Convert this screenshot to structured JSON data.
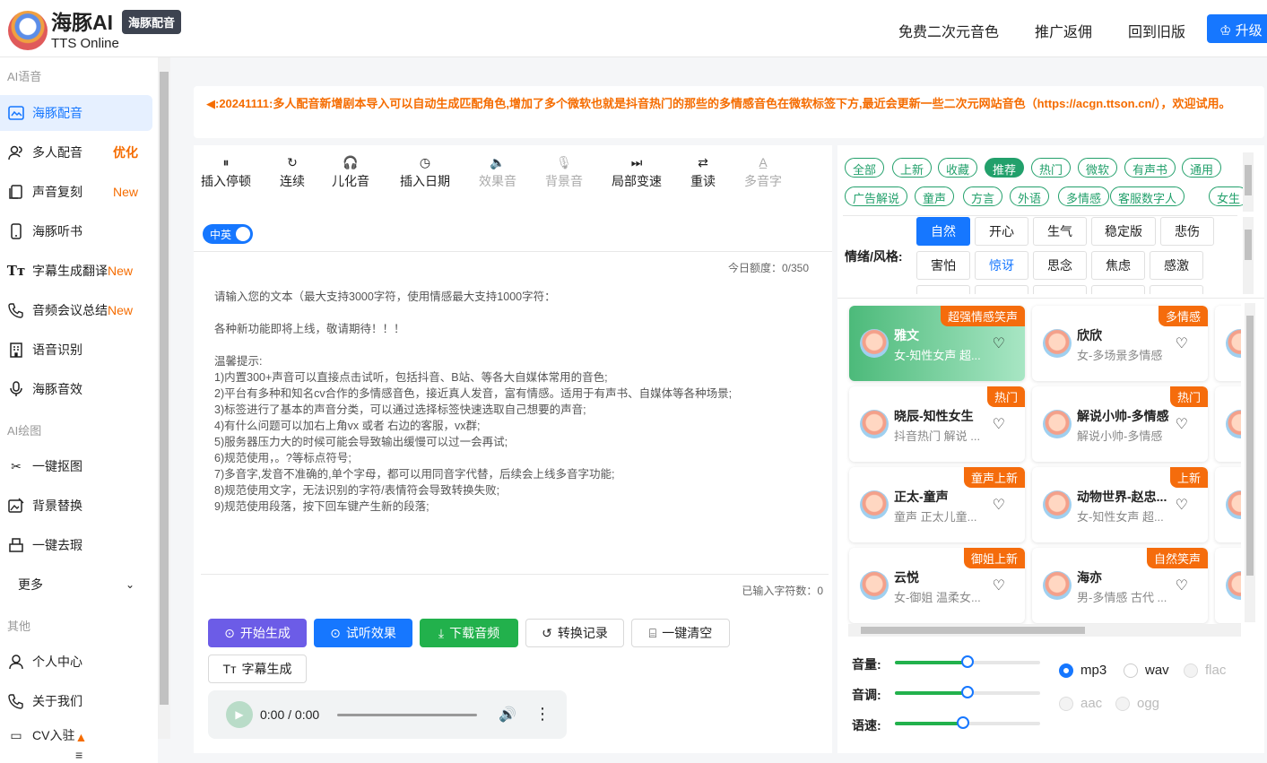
{
  "header": {
    "brand": "海豚AI",
    "brand_tag": "海豚配音",
    "brand_sub": "TTS Online",
    "nav": [
      "免费二次元音色",
      "推广返佣",
      "回到旧版"
    ],
    "upgrade": "升级"
  },
  "sidebar": {
    "sec_voice": "AI语音",
    "sec_draw": "AI绘图",
    "sec_other": "其他",
    "items": [
      {
        "label": "海豚配音",
        "badge": ""
      },
      {
        "label": "多人配音",
        "badge": "优化"
      },
      {
        "label": "声音复刻",
        "badge": "New"
      },
      {
        "label": "海豚听书",
        "badge": ""
      },
      {
        "label": "字幕生成翻译",
        "badge": "New"
      },
      {
        "label": "音频会议总结",
        "badge": "New"
      },
      {
        "label": "语音识别",
        "badge": ""
      },
      {
        "label": "海豚音效",
        "badge": ""
      },
      {
        "label": "一键抠图",
        "badge": ""
      },
      {
        "label": "背景替换",
        "badge": ""
      },
      {
        "label": "一键去瑕",
        "badge": ""
      },
      {
        "label": "更多",
        "badge": ""
      },
      {
        "label": "个人中心",
        "badge": ""
      },
      {
        "label": "关于我们",
        "badge": ""
      },
      {
        "label": "CV入驻",
        "badge": ""
      }
    ]
  },
  "notice": "◀:20241111:多人配音新增剧本导入可以自动生成匹配角色,增加了多个微软也就是抖音热门的那些的多情感音色在微软标签下方,最近会更新一些二次元网站音色（https://acgn.ttson.cn/），欢迎试用。",
  "toolbar": [
    "插入停顿",
    "连续",
    "儿化音",
    "插入日期",
    "效果音",
    "背景音",
    "局部变速",
    "重读",
    "多音字"
  ],
  "toggle": "中英",
  "quota": "今日额度：0/350",
  "textarea": "请输入您的文本（最大支持3000字符，使用情感最大支持1000字符：\n\n各种新功能即将上线，敬请期待！！！\n\n温馨提示:\n1)内置300+声音可以直接点击试听，包括抖音、B站、等各大自媒体常用的音色;\n2)平台有多种和知名cv合作的多情感音色，接近真人发音，富有情感。适用于有声书、自媒体等各种场景;\n3)标签进行了基本的声音分类，可以通过选择标签快速选取自己想要的声音;\n4)有什么问题可以加右上角vx 或者 右边的客服，vx群;\n5)服务器压力大的时候可能会导致输出缓慢可以过一会再试;\n6)规范使用，。?等标点符号;\n7)多音字,发音不准确的,单个字母，都可以用同音字代替，后续会上线多音字功能;\n8)规范使用文字，无法识别的字符/表情符会导致转换失败;\n9)规范使用段落，按下回车键产生新的段落;",
  "char_count": "已输入字符数：0",
  "buttons": {
    "generate": "开始生成",
    "preview": "试听效果",
    "download": "下载音频",
    "history": "转换记录",
    "clear": "一键清空",
    "subtitle": "字幕生成"
  },
  "audio": {
    "time": "0:00 / 0:00"
  },
  "tags": [
    "全部",
    "上新",
    "收藏",
    "推荐",
    "热门",
    "微软",
    "有声书",
    "通用",
    "广告解说",
    "童声",
    "方言",
    "外语",
    "多情感",
    "客服数字人",
    "女生"
  ],
  "emotion": {
    "label": "情绪/风格:",
    "options": [
      "自然",
      "开心",
      "生气",
      "稳定版",
      "悲伤",
      "害怕",
      "惊讶",
      "思念",
      "焦虑",
      "感激"
    ]
  },
  "voices": [
    {
      "name": "雅文",
      "desc": "女-知性女声 超...",
      "badge": "超强情感笑声"
    },
    {
      "name": "欣欣",
      "desc": "女-多场景多情感",
      "badge": "多情感"
    },
    {
      "name": "晓辰-知性女生",
      "desc": "抖音热门 解说 ...",
      "badge": "热门"
    },
    {
      "name": "解说小帅-多情感",
      "desc": "解说小帅-多情感",
      "badge": "热门"
    },
    {
      "name": "正太-童声",
      "desc": "童声 正太儿童...",
      "badge": "童声上新"
    },
    {
      "name": "动物世界-赵忠...",
      "desc": "女-知性女声 超...",
      "badge": "上新"
    },
    {
      "name": "云悦",
      "desc": "女-御姐 温柔女...",
      "badge": "御姐上新"
    },
    {
      "name": "海亦",
      "desc": "男-多情感 古代 ...",
      "badge": "自然笑声"
    }
  ],
  "sliders": {
    "volume_label": "音量:",
    "pitch_label": "音调:",
    "speed_label": "语速:",
    "volume": 0.5,
    "pitch": 0.5,
    "speed": 0.47
  },
  "formats": [
    "mp3",
    "wav",
    "flac",
    "aac",
    "ogg"
  ],
  "colors": {
    "primary": "#1677ff",
    "green": "#22b14c",
    "orange": "#f56c00",
    "purple": "#6c5ce7"
  }
}
